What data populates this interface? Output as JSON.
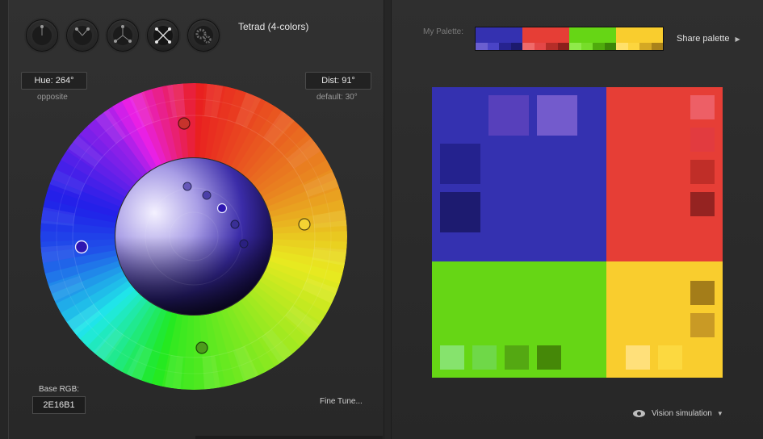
{
  "scheme_buttons": [
    {
      "name": "mono-scheme-button",
      "active": false
    },
    {
      "name": "triad-scheme-button",
      "active": false
    },
    {
      "name": "tetrad-scheme-button",
      "active": false
    },
    {
      "name": "tetrad-4-colors-button",
      "active": true
    },
    {
      "name": "settings-gear-button",
      "active": false
    }
  ],
  "scheme_title": "Tetrad (4-colors)",
  "hue": {
    "value": "Hue: 264°",
    "hint": "opposite"
  },
  "dist": {
    "value": "Dist: 91°",
    "hint": "default: 30°"
  },
  "base_rgb": {
    "label": "Base RGB:",
    "value": "2E16B1"
  },
  "fine_tune": "Fine Tune...",
  "my_palette": {
    "label": "My Palette:",
    "columns": [
      {
        "main": "#3431b0",
        "subs": [
          "#6a5fd0",
          "#4a44c6",
          "#26238f",
          "#1c1a6e"
        ]
      },
      {
        "main": "#e63e36",
        "subs": [
          "#ef6a6a",
          "#e44747",
          "#b52d28",
          "#8b1f1c"
        ]
      },
      {
        "main": "#66d615",
        "subs": [
          "#8fea4a",
          "#77dd2a",
          "#4fab0c",
          "#3c8508"
        ]
      },
      {
        "main": "#f9cd2e",
        "subs": [
          "#ffe06a",
          "#fcd53e",
          "#d4a824",
          "#a9821a"
        ]
      }
    ]
  },
  "share": "Share palette",
  "vision": "Vision simulation",
  "preview_colors": {
    "blue": "#3431b0",
    "red": "#e63e36",
    "green": "#66d615",
    "yellow": "#f9cd2e",
    "blue_swatches": [
      "#5740bb",
      "#735bcc",
      "#24228e",
      "#1d1b70"
    ],
    "red_swatches": [
      "#ed5f66",
      "#e23b3f",
      "#c02e28",
      "#952321"
    ],
    "green_swatches": [
      "#86e36d",
      "#6fd848",
      "#54a812",
      "#458808"
    ],
    "yellow_swatches": [
      "#ffe07a",
      "#fcd940",
      "#a47d19",
      "#c99a25"
    ]
  }
}
